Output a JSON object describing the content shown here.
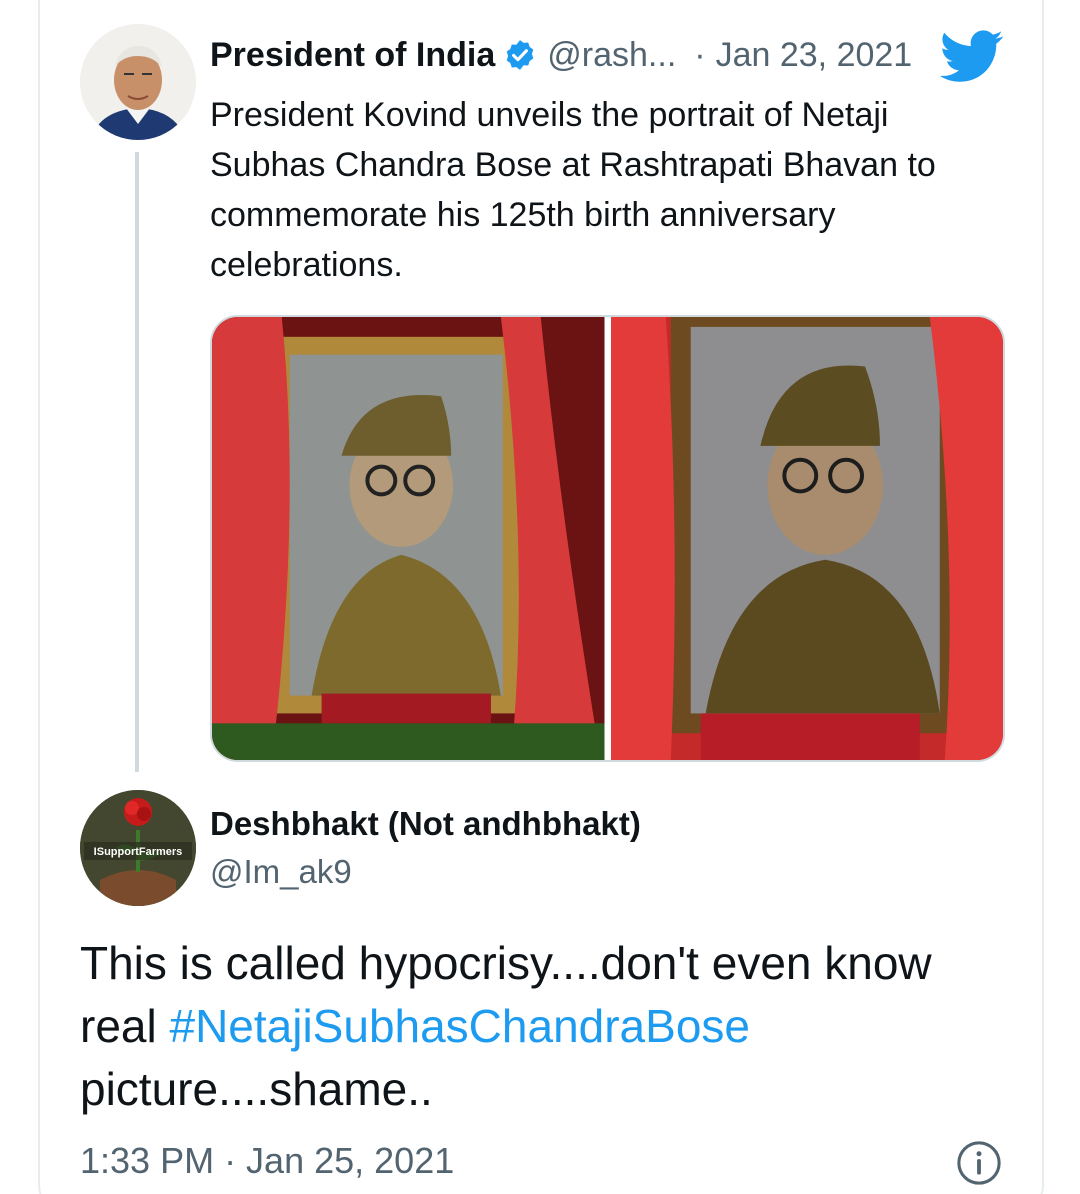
{
  "quoted_tweet": {
    "display_name": "President of India",
    "handle": "@rash...",
    "separator": "·",
    "date": "Jan 23, 2021",
    "text": "President Kovind unveils the portrait of Netaji Subhas Chandra Bose at Rashtrapati Bhavan to commemorate his 125th birth anniversary celebrations.",
    "photos": [
      "portrait-photo-1",
      "portrait-photo-2"
    ]
  },
  "reply_tweet": {
    "display_name": "Deshbhakt (Not andhbhakt)",
    "handle": "@Im_ak9",
    "avatar_badge": "ISupportFarmers",
    "text_before": "This is called hypocrisy....don't even know real ",
    "hashtag": "#NetajiSubhasChandraBose",
    "text_after": " picture....shame..",
    "timestamp": "1:33 PM · Jan 25, 2021"
  },
  "icons": {
    "verified": "verified-badge-icon",
    "twitter": "twitter-bird-icon",
    "info": "info-icon"
  },
  "colors": {
    "link": "#1d9bf0",
    "secondary_text": "#536471",
    "primary_text": "#0f1419",
    "border": "#cfd9de"
  }
}
